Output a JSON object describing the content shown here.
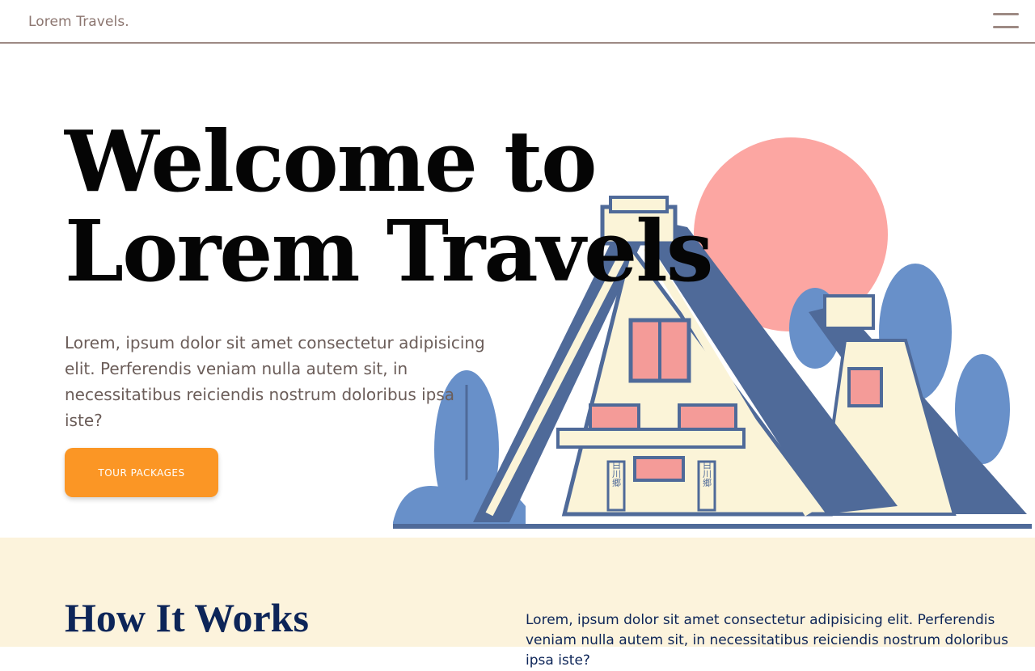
{
  "navbar": {
    "brand": "Lorem Travels.",
    "menu_icon": "hamburger-menu-icon"
  },
  "hero": {
    "title": "Welcome to Lorem Travels",
    "text": "Lorem, ipsum dolor sit amet consectetur adipisicing elit. Perferendis veniam nulla autem sit, in necessitatibus reiciendis nostrum doloribus ipsa iste?",
    "cta_label": "TOUR PACKAGES",
    "sign_text_left": "白川郷",
    "sign_text_right": "白川郷"
  },
  "how_it_works": {
    "title": "How It Works",
    "text": "Lorem, ipsum dolor sit amet consectetur adipisicing elit. Perferendis veniam nulla autem sit, in necessitatibus reiciendis nostrum doloribus ipsa iste?"
  },
  "colors": {
    "accent": "#fb9625",
    "brand": "#8c7670",
    "navy": "#0d2558",
    "sun": "#fca6a2",
    "roof": "#4f6a99",
    "tree": "#6890c9",
    "cream": "#fcf3dc"
  }
}
